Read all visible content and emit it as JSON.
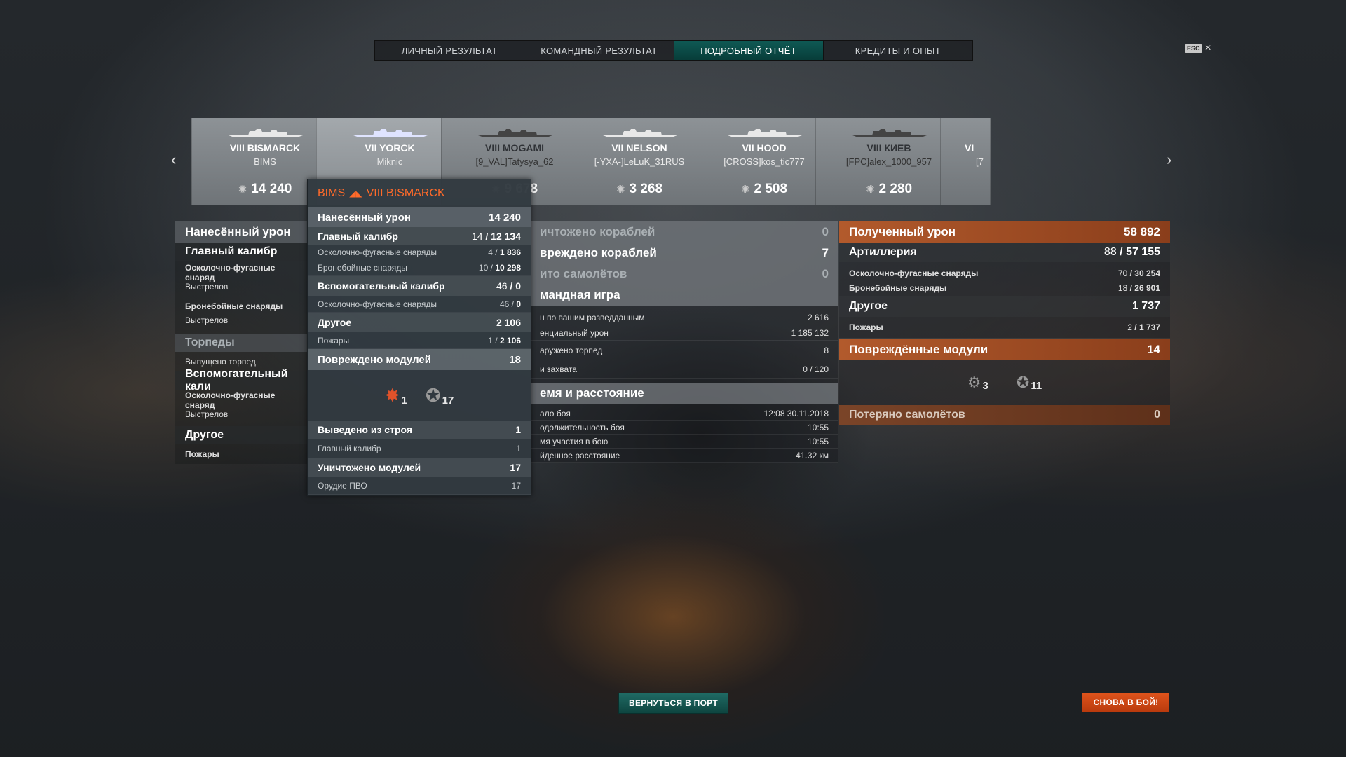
{
  "tabs": [
    {
      "label": "ЛИЧНЫЙ РЕЗУЛЬТАТ"
    },
    {
      "label": "КОМАНДНЫЙ РЕЗУЛЬТАТ"
    },
    {
      "label": "ПОДРОБНЫЙ ОТЧЁТ",
      "active": true
    },
    {
      "label": "КРЕДИТЫ И ОПЫТ"
    }
  ],
  "esc": {
    "key": "ESC",
    "close": "×"
  },
  "ships": [
    {
      "tier": "VIII BISMARCK",
      "player": "BIMS",
      "damage": "14 240"
    },
    {
      "tier": "VII YORCK",
      "player": "Miknic",
      "damage": ""
    },
    {
      "tier": "VIII MOGAMI",
      "player": "[9_VAL]Tatysya_62",
      "damage": "9 678"
    },
    {
      "tier": "VII NELSON",
      "player": "[-YXA-]LeLuK_31RUS",
      "damage": "3 268"
    },
    {
      "tier": "VII HOOD",
      "player": "[CROSS]kos_tic777",
      "damage": "2 508"
    },
    {
      "tier": "VIII КИЕВ",
      "player": "[FPC]alex_1000_957",
      "damage": "2 280"
    },
    {
      "tier": "VI",
      "player": "[7",
      "damage": ""
    }
  ],
  "left": {
    "damage_dealt": "Нанесённый урон",
    "main_caliber": "Главный калибр",
    "he_shells": "Осколочно-фугасные снаряд",
    "shots1": "Выстрелов",
    "ap_shells": "Бронебойные снаряды",
    "shots2": "Выстрелов",
    "torpedoes": "Торпеды",
    "torpedoes_launched": "Выпущено торпед",
    "secondary": "Вспомогательный кали",
    "he_shells2": "Осколочно-фугасные снаряд",
    "shots3": "Выстрелов",
    "other": "Другое",
    "fires": "Пожары"
  },
  "mid": {
    "ships_destroyed": "ичтожено кораблей",
    "ships_destroyed_v": "0",
    "ships_damaged": "вреждено кораблей",
    "ships_damaged_v": "7",
    "planes_destroyed": "ито самолётов",
    "planes_destroyed_v": "0",
    "team_play": "мандная игра",
    "spotting_damage": "н по вашим разведданным",
    "spotting_damage_v": "2 616",
    "potential_damage": "енциальный урон",
    "potential_damage_v": "1 185 132",
    "torpedoes_spotted": "аружено торпед",
    "torpedoes_spotted_v": "8",
    "capture_points": "и захвата",
    "capture_points_v": "0 / 120",
    "time_distance": "емя и расстояние",
    "battle_start": "ало боя",
    "battle_start_v": "12:08  30.11.2018",
    "battle_duration": "одолжительность боя",
    "battle_duration_v": "10:55",
    "participation_time": "мя участия в бою",
    "participation_time_v": "10:55",
    "distance": "йденное расстояние",
    "distance_v": "41.32 км"
  },
  "right": {
    "received": "Полученный урон",
    "received_v": "58 892",
    "artillery": "Артиллерия",
    "artillery_hits": "88",
    "artillery_v": "57 155",
    "he": "Осколочно-фугасные снаряды",
    "he_hits": "70",
    "he_v": "30 254",
    "ap": "Бронебойные снаряды",
    "ap_hits": "18",
    "ap_v": "26 901",
    "other": "Другое",
    "other_v": "1 737",
    "fires": "Пожары",
    "fires_hits": "2",
    "fires_v": "1 737",
    "damaged_modules": "Повреждённые модули",
    "damaged_modules_v": "14",
    "mod1_v": "3",
    "mod2_v": "11",
    "planes_lost": "Потеряно самолётов",
    "planes_lost_v": "0"
  },
  "tooltip": {
    "player": "BIMS",
    "ship": "VIII BISMARCK",
    "damage": "Нанесённый урон",
    "damage_v": "14 240",
    "main": "Главный калибр",
    "main_hits": "14",
    "main_v": "12 134",
    "he": "Осколочно-фугасные снаряды",
    "he_hits": "4",
    "he_v": "1 836",
    "ap": "Бронебойные снаряды",
    "ap_hits": "10",
    "ap_v": "10 298",
    "secondary": "Вспомогательный калибр",
    "secondary_hits": "46",
    "secondary_v": "0",
    "sec_he": "Осколочно-фугасные снаряды",
    "sec_he_hits": "46",
    "sec_he_v": "0",
    "other": "Другое",
    "other_v": "2 106",
    "fires": "Пожары",
    "fires_hits": "1",
    "fires_v": "2 106",
    "damaged_modules": "Повреждено модулей",
    "damaged_modules_v": "18",
    "mod1_v": "1",
    "mod2_v": "17",
    "incapacitated": "Выведено из строя",
    "incapacitated_v": "1",
    "inc_main": "Главный калибр",
    "inc_main_v": "1",
    "destroyed_modules": "Уничтожено модулей",
    "destroyed_modules_v": "17",
    "aa_guns": "Орудие ПВО",
    "aa_guns_v": "17"
  },
  "buttons": {
    "port": "ВЕРНУТЬСЯ В ПОРТ",
    "battle": "СНОВА В БОЙ!"
  },
  "colors": {
    "accent_orange": "#b25a2c",
    "teal": "#0f5a55",
    "tooltip_title": "#ff6a2a"
  }
}
